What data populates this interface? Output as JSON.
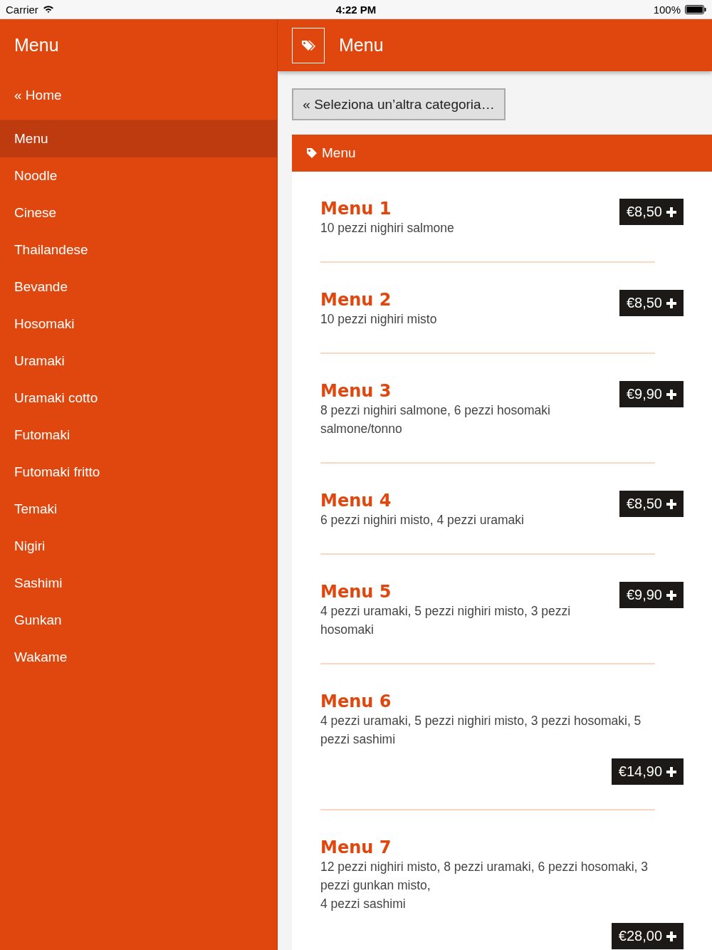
{
  "status_bar": {
    "carrier": "Carrier",
    "time": "4:22 PM",
    "battery": "100%"
  },
  "sidebar": {
    "title": "Menu",
    "home": "« Home",
    "items": [
      {
        "label": "Menu",
        "selected": true
      },
      {
        "label": "Noodle",
        "selected": false
      },
      {
        "label": "Cinese",
        "selected": false
      },
      {
        "label": "Thailandese",
        "selected": false
      },
      {
        "label": "Bevande",
        "selected": false
      },
      {
        "label": "Hosomaki",
        "selected": false
      },
      {
        "label": "Uramaki",
        "selected": false
      },
      {
        "label": "Uramaki cotto",
        "selected": false
      },
      {
        "label": "Futomaki",
        "selected": false
      },
      {
        "label": "Futomaki fritto",
        "selected": false
      },
      {
        "label": "Temaki",
        "selected": false
      },
      {
        "label": "Nigiri",
        "selected": false
      },
      {
        "label": "Sashimi",
        "selected": false
      },
      {
        "label": "Gunkan",
        "selected": false
      },
      {
        "label": "Wakame",
        "selected": false
      }
    ]
  },
  "header": {
    "title": "Menu"
  },
  "back_button": "« Seleziona un’altra categoria…",
  "panel": {
    "title": "Menu",
    "items": [
      {
        "name": "Menu 1",
        "kind": "inline",
        "lines": [
          "10 pezzi nighiri salmone"
        ],
        "price": "€8,50"
      },
      {
        "name": "Menu 2",
        "kind": "inline",
        "lines": [
          "10 pezzi nighiri misto"
        ],
        "price": "€8,50"
      },
      {
        "name": "Menu 3",
        "kind": "inline",
        "lines": [
          "8 pezzi nighiri salmone, 6 pezzi hosomaki salmone/tonno"
        ],
        "price": "€9,90"
      },
      {
        "name": "Menu 4",
        "kind": "inline",
        "lines": [
          "6 pezzi nighiri misto, 4 pezzi uramaki"
        ],
        "price": "€8,50"
      },
      {
        "name": "Menu 5",
        "kind": "inline",
        "lines": [
          "4 pezzi uramaki, 5 pezzi nighiri misto, 3 pezzi hosomaki"
        ],
        "price": "€9,90"
      },
      {
        "name": "Menu 6",
        "kind": "stacked",
        "lines": [
          "4 pezzi uramaki, 5 pezzi nighiri misto, 3 pezzi hosomaki, 5 pezzi sashimi"
        ],
        "price": "€14,90"
      },
      {
        "name": "Menu 7",
        "kind": "stacked",
        "lines": [
          "12 pezzi nighiri misto, 8 pezzi uramaki, 6 pezzi hosomaki, 3 pezzi gunkan misto,",
          "4 pezzi sashimi"
        ],
        "price": "€28,00"
      }
    ]
  }
}
